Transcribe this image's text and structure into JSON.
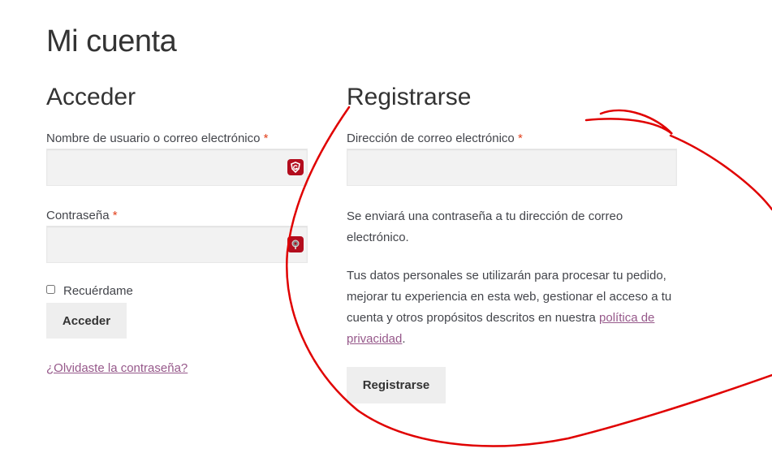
{
  "page": {
    "title": "Mi cuenta"
  },
  "login": {
    "heading": "Acceder",
    "username_label": "Nombre de usuario o correo electrónico",
    "password_label": "Contraseña",
    "required_mark": "*",
    "remember_label": "Recuérdame",
    "submit_label": "Acceder",
    "lost_password_link": "¿Olvidaste la contraseña?"
  },
  "register": {
    "heading": "Registrarse",
    "email_label": "Dirección de correo electrónico",
    "required_mark": "*",
    "password_notice": "Se enviará una contraseña a tu dirección de correo electrónico.",
    "privacy_text": "Tus datos personales se utilizarán para procesar tu pedido, mejorar tu experiencia en esta web, gestionar el acceso a tu cuenta y otros propósitos descritos en nuestra",
    "privacy_link": "política de privacidad",
    "privacy_end": ".",
    "submit_label": "Registrarse"
  },
  "icons": {
    "username_field_icon": "shield-g-icon",
    "password_field_icon": "key-icon"
  },
  "colors": {
    "required": "#e2401c",
    "link": "#96588a",
    "annotation": "#e00000",
    "icon_bg": "#b30d1e"
  }
}
